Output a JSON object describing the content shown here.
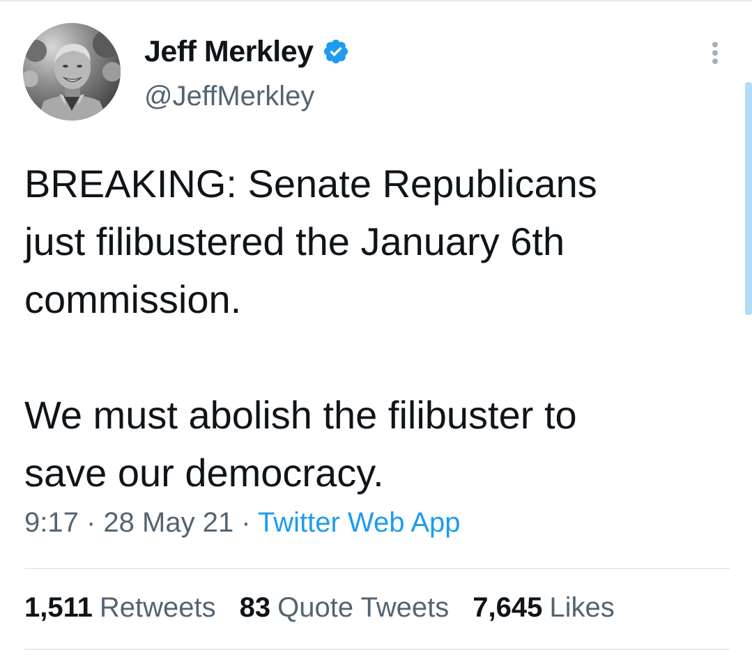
{
  "tweet": {
    "author": {
      "display_name": "Jeff Merkley",
      "handle": "@JeffMerkley",
      "verified": true,
      "verified_color": "#1d9bf0"
    },
    "text_lines": [
      "BREAKING: Senate Republicans",
      "just filibustered the January 6th",
      "commission.",
      "",
      "We must abolish the filibuster to",
      "save our democracy."
    ],
    "time": "9:17",
    "date": "28 May 21",
    "source": "Twitter Web App",
    "separator": " · ",
    "stats": {
      "retweets": {
        "count": "1,511",
        "label": "Retweets"
      },
      "quotes": {
        "count": "83",
        "label": "Quote Tweets"
      },
      "likes": {
        "count": "7,645",
        "label": "Likes"
      }
    },
    "icons": {
      "more": "more-vertical-icon",
      "verified": "verified-badge-icon"
    },
    "colors": {
      "text": "#0f1419",
      "secondary": "#536471",
      "link": "#1d9bf0",
      "divider": "#e6ecf0"
    }
  }
}
